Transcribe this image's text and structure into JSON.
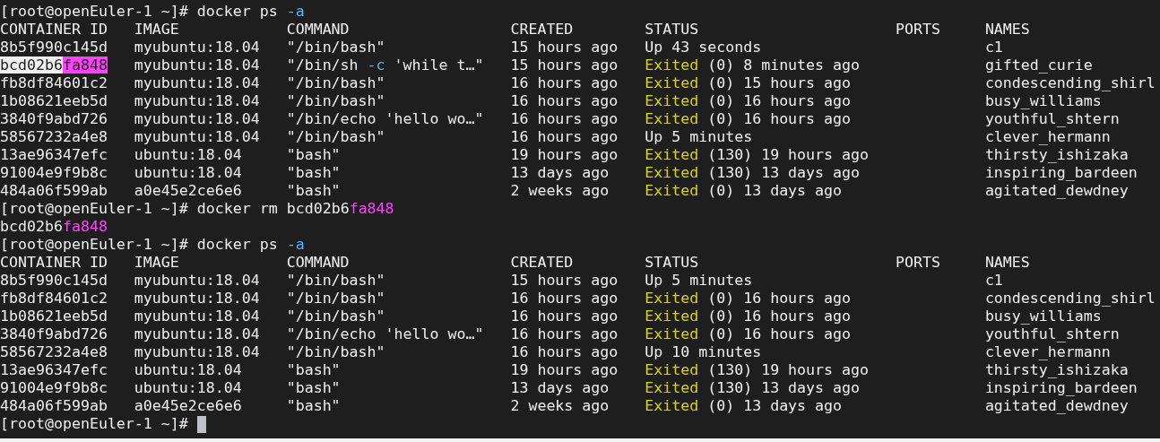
{
  "terminal": {
    "lines": [
      {
        "kind": "prompt",
        "prompt": "[root@openEuler-1 ~]#",
        "command": [
          {
            "text": "docker ps "
          },
          {
            "text": "-a",
            "kind": "flag"
          }
        ],
        "cursor": false
      },
      {
        "kind": "table",
        "columns": [
          "CONTAINER ID",
          "IMAGE",
          "COMMAND",
          "CREATED",
          "STATUS",
          "PORTS",
          "NAMES"
        ],
        "rows": [
          {
            "id": [
              {
                "text": "8b5f990c145d"
              }
            ],
            "image": "myubuntu:18.04",
            "command": [
              {
                "text": "\"/bin/bash\""
              }
            ],
            "created": "15 hours ago",
            "status": [
              {
                "text": "Up 43 seconds"
              }
            ],
            "names": "c1"
          },
          {
            "id": [
              {
                "text": "bcd02b6",
                "kind": "selection"
              },
              {
                "text": "fa848",
                "kind": "match"
              }
            ],
            "image": "myubuntu:18.04",
            "command": [
              {
                "text": "\"/bin/sh "
              },
              {
                "text": "-c",
                "kind": "flag"
              },
              {
                "text": " 'while t…\""
              }
            ],
            "created": "15 hours ago",
            "status": [
              {
                "text": "Exited",
                "kind": "warning"
              },
              {
                "text": " (0) 8 minutes ago"
              }
            ],
            "names": "gifted_curie"
          },
          {
            "id": [
              {
                "text": "fb8df84601c2"
              }
            ],
            "image": "myubuntu:18.04",
            "command": [
              {
                "text": "\"/bin/bash\""
              }
            ],
            "created": "16 hours ago",
            "status": [
              {
                "text": "Exited",
                "kind": "warning"
              },
              {
                "text": " (0) 15 hours ago"
              }
            ],
            "names": "condescending_shirl"
          },
          {
            "id": [
              {
                "text": "1b08621eeb5d"
              }
            ],
            "image": "myubuntu:18.04",
            "command": [
              {
                "text": "\"/bin/bash\""
              }
            ],
            "created": "16 hours ago",
            "status": [
              {
                "text": "Exited",
                "kind": "warning"
              },
              {
                "text": " (0) 16 hours ago"
              }
            ],
            "names": "busy_williams"
          },
          {
            "id": [
              {
                "text": "3840f9abd726"
              }
            ],
            "image": "myubuntu:18.04",
            "command": [
              {
                "text": "\"/bin/echo 'hello wo…\""
              }
            ],
            "created": "16 hours ago",
            "status": [
              {
                "text": "Exited",
                "kind": "warning"
              },
              {
                "text": " (0) 16 hours ago"
              }
            ],
            "names": "youthful_shtern"
          },
          {
            "id": [
              {
                "text": "58567232a4e8"
              }
            ],
            "image": "myubuntu:18.04",
            "command": [
              {
                "text": "\"/bin/bash\""
              }
            ],
            "created": "16 hours ago",
            "status": [
              {
                "text": "Up 5 minutes"
              }
            ],
            "names": "clever_hermann"
          },
          {
            "id": [
              {
                "text": "13ae96347efc"
              }
            ],
            "image": "ubuntu:18.04",
            "command": [
              {
                "text": "\"bash\""
              }
            ],
            "created": "19 hours ago",
            "status": [
              {
                "text": "Exited",
                "kind": "warning"
              },
              {
                "text": " (130) 19 hours ago"
              }
            ],
            "names": "thirsty_ishizaka"
          },
          {
            "id": [
              {
                "text": "91004e9f9b8c"
              }
            ],
            "image": "ubuntu:18.04",
            "command": [
              {
                "text": "\"bash\""
              }
            ],
            "created": "13 days ago",
            "status": [
              {
                "text": "Exited",
                "kind": "warning"
              },
              {
                "text": " (130) 13 days ago"
              }
            ],
            "names": "inspiring_bardeen"
          },
          {
            "id": [
              {
                "text": "484a06f599ab"
              }
            ],
            "image": "a0e45e2ce6e6",
            "command": [
              {
                "text": "\"bash\""
              }
            ],
            "created": "2 weeks ago",
            "status": [
              {
                "text": "Exited",
                "kind": "warning"
              },
              {
                "text": " (0) 13 days ago"
              }
            ],
            "names": "agitated_dewdney"
          }
        ]
      },
      {
        "kind": "prompt",
        "prompt": "[root@openEuler-1 ~]#",
        "command": [
          {
            "text": "docker rm bcd02b6"
          },
          {
            "text": "fa848",
            "kind": "match-text"
          }
        ],
        "cursor": false
      },
      {
        "kind": "output",
        "segments": [
          {
            "text": "bcd02b6"
          },
          {
            "text": "fa848",
            "kind": "match-text"
          }
        ]
      },
      {
        "kind": "prompt",
        "prompt": "[root@openEuler-1 ~]#",
        "command": [
          {
            "text": "docker ps "
          },
          {
            "text": "-a",
            "kind": "flag"
          }
        ],
        "cursor": false
      },
      {
        "kind": "table",
        "columns": [
          "CONTAINER ID",
          "IMAGE",
          "COMMAND",
          "CREATED",
          "STATUS",
          "PORTS",
          "NAMES"
        ],
        "rows": [
          {
            "id": [
              {
                "text": "8b5f990c145d"
              }
            ],
            "image": "myubuntu:18.04",
            "command": [
              {
                "text": "\"/bin/bash\""
              }
            ],
            "created": "15 hours ago",
            "status": [
              {
                "text": "Up 5 minutes"
              }
            ],
            "names": "c1"
          },
          {
            "id": [
              {
                "text": "fb8df84601c2"
              }
            ],
            "image": "myubuntu:18.04",
            "command": [
              {
                "text": "\"/bin/bash\""
              }
            ],
            "created": "16 hours ago",
            "status": [
              {
                "text": "Exited",
                "kind": "warning"
              },
              {
                "text": " (0) 16 hours ago"
              }
            ],
            "names": "condescending_shirl"
          },
          {
            "id": [
              {
                "text": "1b08621eeb5d"
              }
            ],
            "image": "myubuntu:18.04",
            "command": [
              {
                "text": "\"/bin/bash\""
              }
            ],
            "created": "16 hours ago",
            "status": [
              {
                "text": "Exited",
                "kind": "warning"
              },
              {
                "text": " (0) 16 hours ago"
              }
            ],
            "names": "busy_williams"
          },
          {
            "id": [
              {
                "text": "3840f9abd726"
              }
            ],
            "image": "myubuntu:18.04",
            "command": [
              {
                "text": "\"/bin/echo 'hello wo…\""
              }
            ],
            "created": "16 hours ago",
            "status": [
              {
                "text": "Exited",
                "kind": "warning"
              },
              {
                "text": " (0) 16 hours ago"
              }
            ],
            "names": "youthful_shtern"
          },
          {
            "id": [
              {
                "text": "58567232a4e8"
              }
            ],
            "image": "myubuntu:18.04",
            "command": [
              {
                "text": "\"/bin/bash\""
              }
            ],
            "created": "16 hours ago",
            "status": [
              {
                "text": "Up 10 minutes"
              }
            ],
            "names": "clever_hermann"
          },
          {
            "id": [
              {
                "text": "13ae96347efc"
              }
            ],
            "image": "ubuntu:18.04",
            "command": [
              {
                "text": "\"bash\""
              }
            ],
            "created": "19 hours ago",
            "status": [
              {
                "text": "Exited",
                "kind": "warning"
              },
              {
                "text": " (130) 19 hours ago"
              }
            ],
            "names": "thirsty_ishizaka"
          },
          {
            "id": [
              {
                "text": "91004e9f9b8c"
              }
            ],
            "image": "ubuntu:18.04",
            "command": [
              {
                "text": "\"bash\""
              }
            ],
            "created": "13 days ago",
            "status": [
              {
                "text": "Exited",
                "kind": "warning"
              },
              {
                "text": " (130) 13 days ago"
              }
            ],
            "names": "inspiring_bardeen"
          },
          {
            "id": [
              {
                "text": "484a06f599ab"
              }
            ],
            "image": "a0e45e2ce6e6",
            "command": [
              {
                "text": "\"bash\""
              }
            ],
            "created": "2 weeks ago",
            "status": [
              {
                "text": "Exited",
                "kind": "warning"
              },
              {
                "text": " (0) 13 days ago"
              }
            ],
            "names": "agitated_dewdney"
          }
        ]
      },
      {
        "kind": "prompt",
        "prompt": "[root@openEuler-1 ~]#",
        "cursor": true
      }
    ]
  }
}
